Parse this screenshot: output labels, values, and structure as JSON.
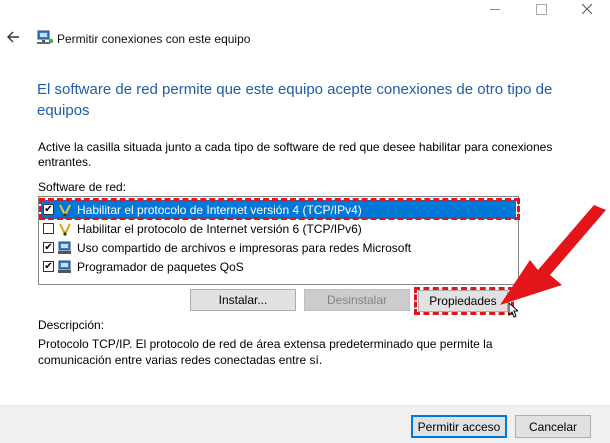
{
  "window": {
    "title": "Permitir conexiones con este equipo",
    "heading": "El software de red permite que este equipo acepte conexiones de otro tipo de equipos",
    "instructions": "Active la casilla situada junto a cada tipo de software de red que desee habilitar para conexiones entrantes."
  },
  "software": {
    "label": "Software de red:",
    "items": [
      {
        "label": "Habilitar el protocolo de Internet versión 4 (TCP/IPv4)",
        "checked": true,
        "selected": true,
        "icon": "network-protocol-icon"
      },
      {
        "label": "Habilitar el protocolo de Internet versión 6 (TCP/IPv6)",
        "checked": false,
        "selected": false,
        "icon": "network-protocol-icon"
      },
      {
        "label": "Uso compartido de archivos e impresoras para redes Microsoft",
        "checked": true,
        "selected": false,
        "icon": "network-service-icon"
      },
      {
        "label": "Programador de paquetes QoS",
        "checked": true,
        "selected": false,
        "icon": "network-service-icon"
      }
    ]
  },
  "buttons": {
    "install": "Instalar...",
    "uninstall": "Desinstalar",
    "properties": "Propiedades",
    "allow": "Permitir acceso",
    "cancel": "Cancelar"
  },
  "description": {
    "label": "Descripción:",
    "text": "Protocolo TCP/IP. El protocolo de red de área extensa predeterminado que permite la comunicación entre varias redes conectadas entre sí."
  },
  "colors": {
    "accent": "#0078d7",
    "heading": "#1f5da8",
    "annotation": "#e4141b"
  }
}
